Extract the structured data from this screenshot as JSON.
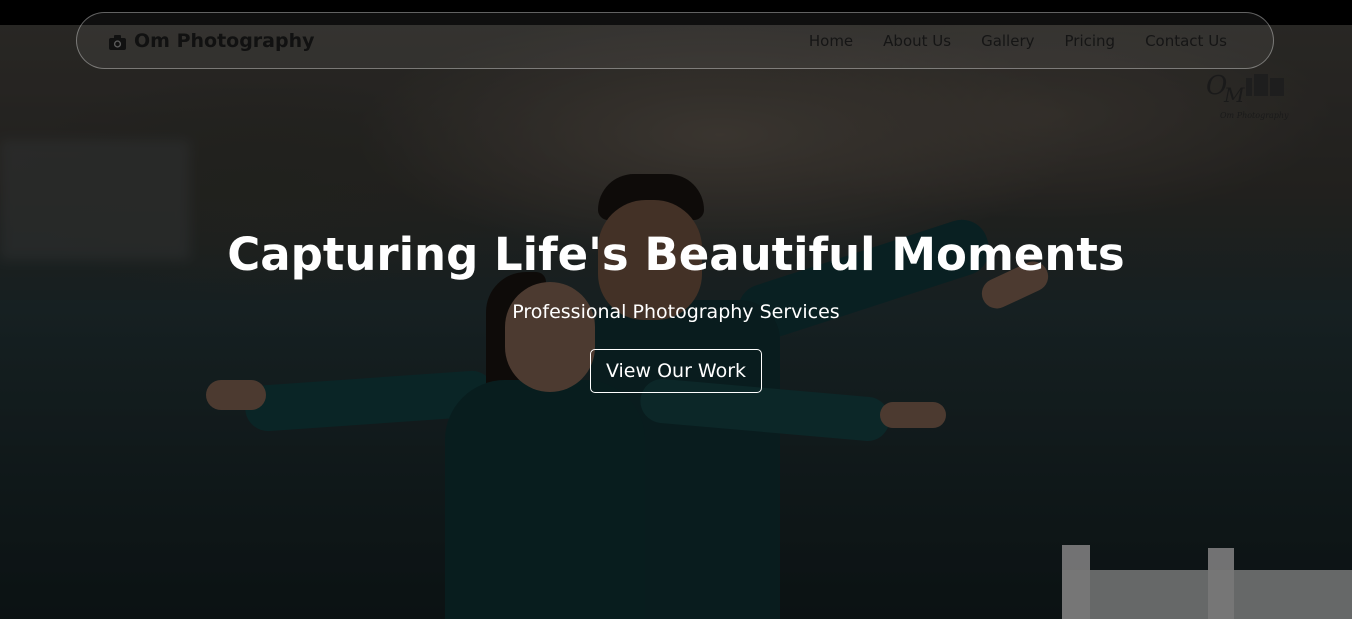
{
  "navbar": {
    "brand_icon": "camera-icon",
    "brand_label": "Om Photography",
    "links": [
      {
        "label": "Home"
      },
      {
        "label": "About Us"
      },
      {
        "label": "Gallery"
      },
      {
        "label": "Pricing"
      },
      {
        "label": "Contact Us"
      }
    ]
  },
  "hero": {
    "title": "Capturing Life's Beautiful Moments",
    "subtitle": "Professional Photography Services",
    "cta_label": "View Our Work"
  },
  "watermark": {
    "logo_letters": "OM",
    "caption": "Om Photography"
  },
  "colors": {
    "overlay": "#000000",
    "text_light": "#ffffff",
    "nav_text": "#151515",
    "dress_teal": "#0f3638"
  }
}
